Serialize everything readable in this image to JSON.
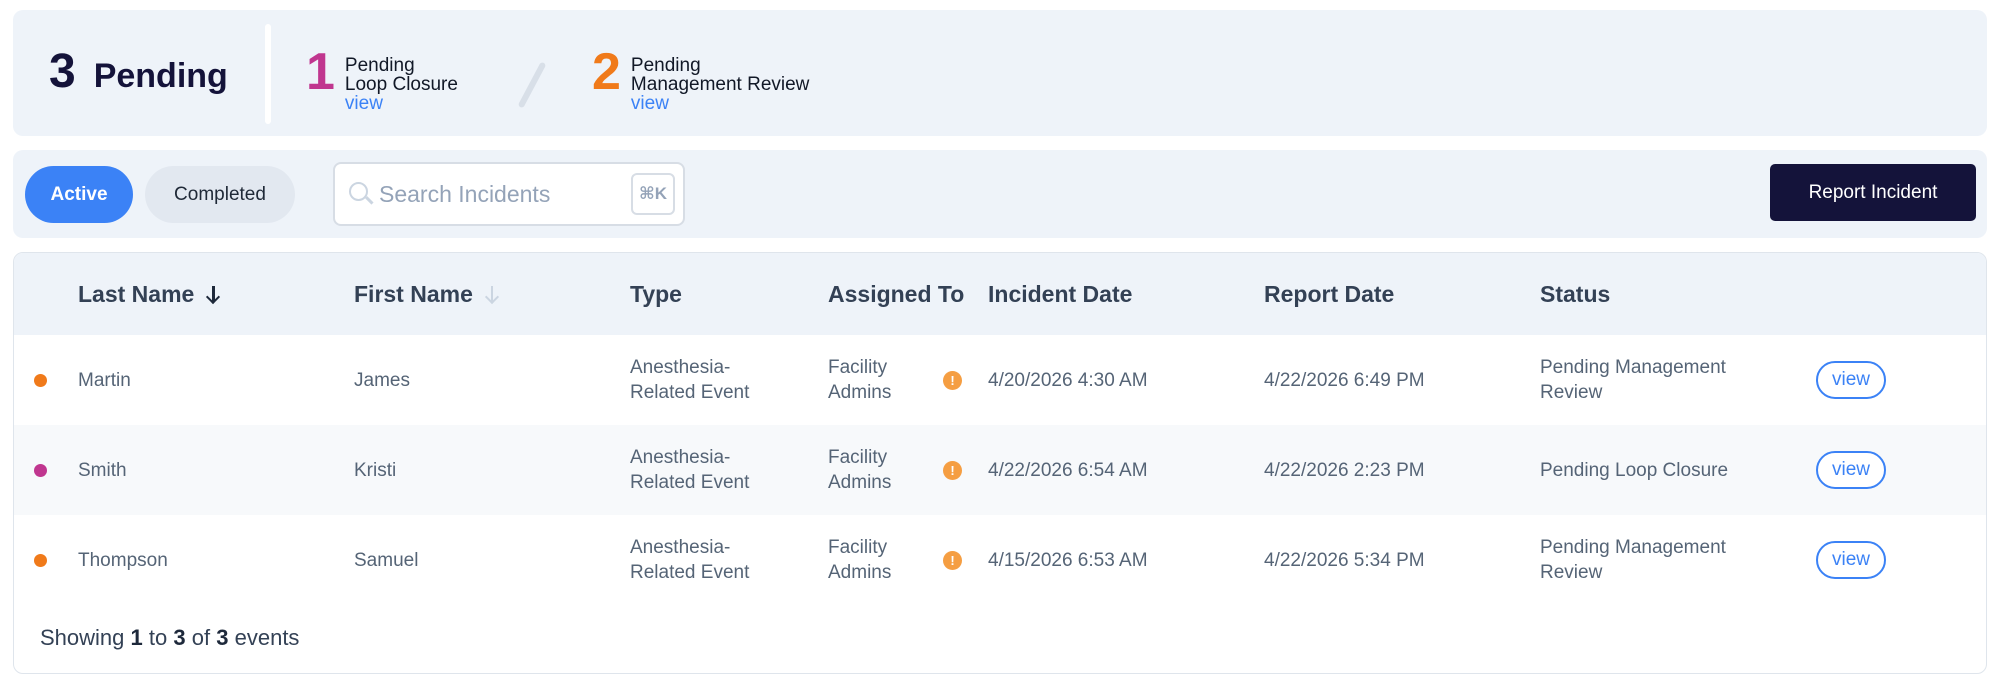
{
  "summary": {
    "total_count": "3",
    "total_label": "Pending",
    "items": [
      {
        "count": "1",
        "line1": "Pending",
        "line2": "Loop Closure",
        "link": "view",
        "color": "#c0368f"
      },
      {
        "count": "2",
        "line1": "Pending",
        "line2": "Management Review",
        "link": "view",
        "color": "#f07a1a"
      }
    ]
  },
  "toolbar": {
    "tabs": [
      {
        "label": "Active",
        "selected": true
      },
      {
        "label": "Completed",
        "selected": false
      }
    ],
    "search_placeholder": "Search Incidents",
    "search_value": "",
    "shortcut": "⌘K",
    "report_button": "Report Incident"
  },
  "table": {
    "columns": [
      "Last Name",
      "First Name",
      "Type",
      "Assigned To",
      "Incident Date",
      "Report Date",
      "Status"
    ],
    "sort": {
      "column": "Last Name",
      "direction": "descending"
    },
    "rows": [
      {
        "status_color": "#f07a1a",
        "last": "Martin",
        "first": "James",
        "type1": "Anesthesia-",
        "type2": "Related Event",
        "assigned1": "Facility",
        "assigned2": "Admins",
        "incident_date": "4/20/2026 4:30 AM",
        "report_date": "4/22/2026 6:49 PM",
        "status1": "Pending Management",
        "status2": "Review",
        "action": "view"
      },
      {
        "status_color": "#c0368f",
        "last": "Smith",
        "first": "Kristi",
        "type1": "Anesthesia-",
        "type2": "Related Event",
        "assigned1": "Facility",
        "assigned2": "Admins",
        "incident_date": "4/22/2026 6:54 AM",
        "report_date": "4/22/2026 2:23 PM",
        "status1": "Pending Loop Closure",
        "status2": "",
        "action": "view"
      },
      {
        "status_color": "#f07a1a",
        "last": "Thompson",
        "first": "Samuel",
        "type1": "Anesthesia-",
        "type2": "Related Event",
        "assigned1": "Facility",
        "assigned2": "Admins",
        "incident_date": "4/15/2026 6:53 AM",
        "report_date": "4/22/2026 5:34 PM",
        "status1": "Pending Management",
        "status2": "Review",
        "action": "view"
      }
    ],
    "assigned_alert_icon": "exclamation-icon"
  },
  "footer": {
    "prefix": "Showing",
    "from": "1",
    "to_word": "to",
    "to": "3",
    "of_word": "of",
    "total": "3",
    "suffix": "events"
  }
}
